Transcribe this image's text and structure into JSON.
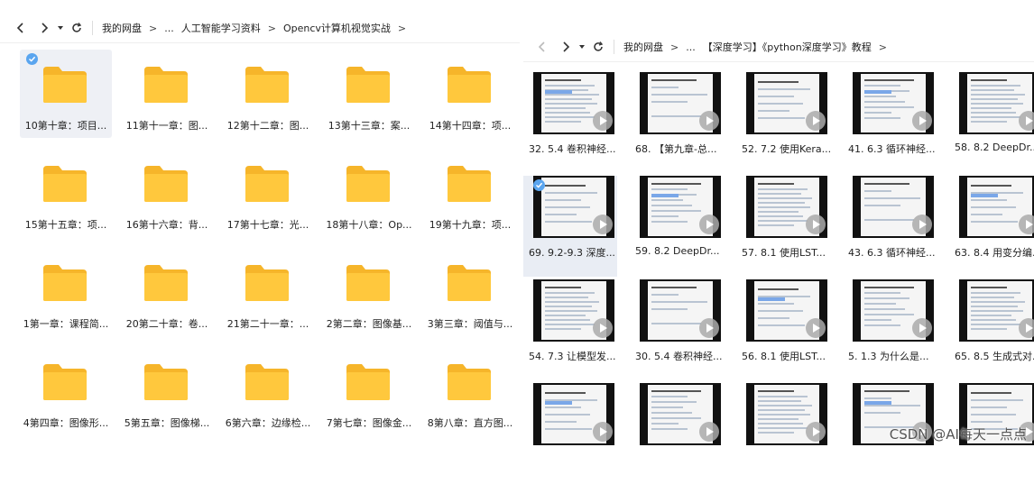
{
  "left": {
    "nav": {
      "breadcrumb": [
        "我的网盘",
        "...",
        "人工智能学习资料",
        "Opencv计算机视觉实战"
      ]
    },
    "folders": [
      "10第十章：项目...",
      "11第十一章：图...",
      "12第十二章：图...",
      "13第十三章：案...",
      "14第十四章：项...",
      "15第十五章：项...",
      "16第十六章：背...",
      "17第十七章：光...",
      "18第十八章：Op...",
      "19第十九章：项...",
      "1第一章：课程简...",
      "20第二十章：卷...",
      "21第二十一章：...",
      "2第二章：图像基...",
      "3第三章：阈值与...",
      "4第四章：图像形...",
      "5第五章：图像梯...",
      "6第六章：边缘检...",
      "7第七章：图像金...",
      "8第八章：直方图..."
    ],
    "selected_folder_index": 0
  },
  "right": {
    "nav": {
      "breadcrumb": [
        "我的网盘",
        "...",
        "【深度学习】《python深度学习》教程"
      ]
    },
    "videos": [
      "32. 5.4 卷积神经...",
      "68. 【第九章-总...",
      "52. 7.2 使用Kera...",
      "41. 6.3 循环神经...",
      "58. 8.2 DeepDr...",
      "69. 9.2-9.3 深度...",
      "59. 8.2 DeepDr...",
      "57. 8.1 使用LST...",
      "43. 6.3 循环神经...",
      "63. 8.4 用变分编...",
      "54. 7.3 让模型发...",
      "30. 5.4 卷积神经...",
      "56. 8.1 使用LST...",
      "5. 1.3 为什么是...",
      "65. 8.5 生成式对...",
      "",
      "",
      "",
      "",
      ""
    ],
    "selected_video_index": 5
  },
  "watermark": "CSDN @AI每天一点点",
  "colors": {
    "folder": "#ffc83d",
    "selection": "#eef0f5",
    "check": "#5aa5ef"
  }
}
